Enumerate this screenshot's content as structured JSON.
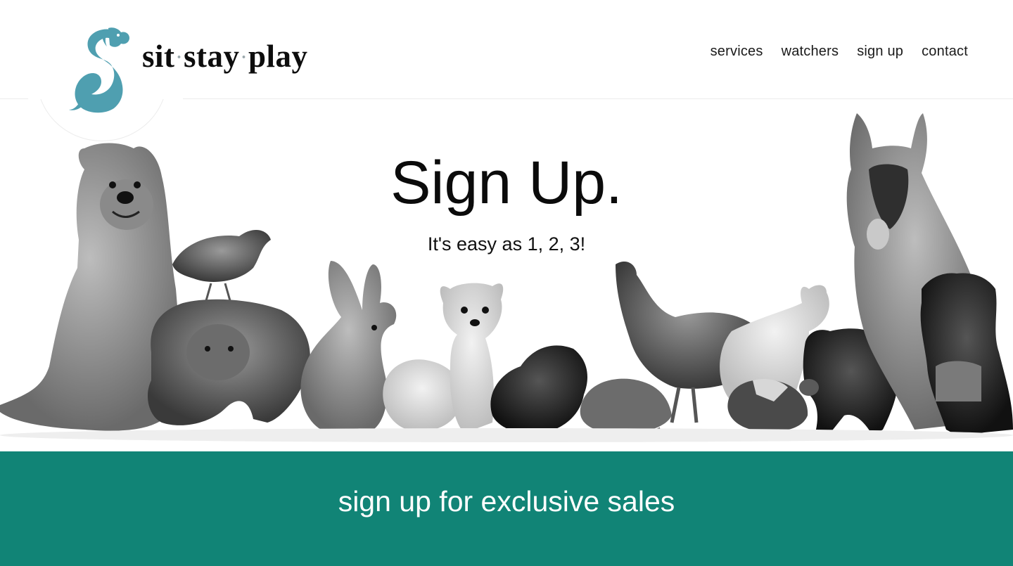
{
  "brand": {
    "name_parts": [
      "sit",
      "stay",
      "play"
    ],
    "separator": "·",
    "logo_icon": "dog-s-logo-icon",
    "accent_color": "#4f9fb0"
  },
  "nav": {
    "items": [
      {
        "label": "services"
      },
      {
        "label": "watchers"
      },
      {
        "label": "sign up"
      },
      {
        "label": "contact"
      }
    ]
  },
  "hero": {
    "title": "Sign Up.",
    "subtitle": "It's easy as 1, 2, 3!",
    "image": "pets-group-photo"
  },
  "banner": {
    "text": "sign up for exclusive sales",
    "color": "#118476"
  }
}
